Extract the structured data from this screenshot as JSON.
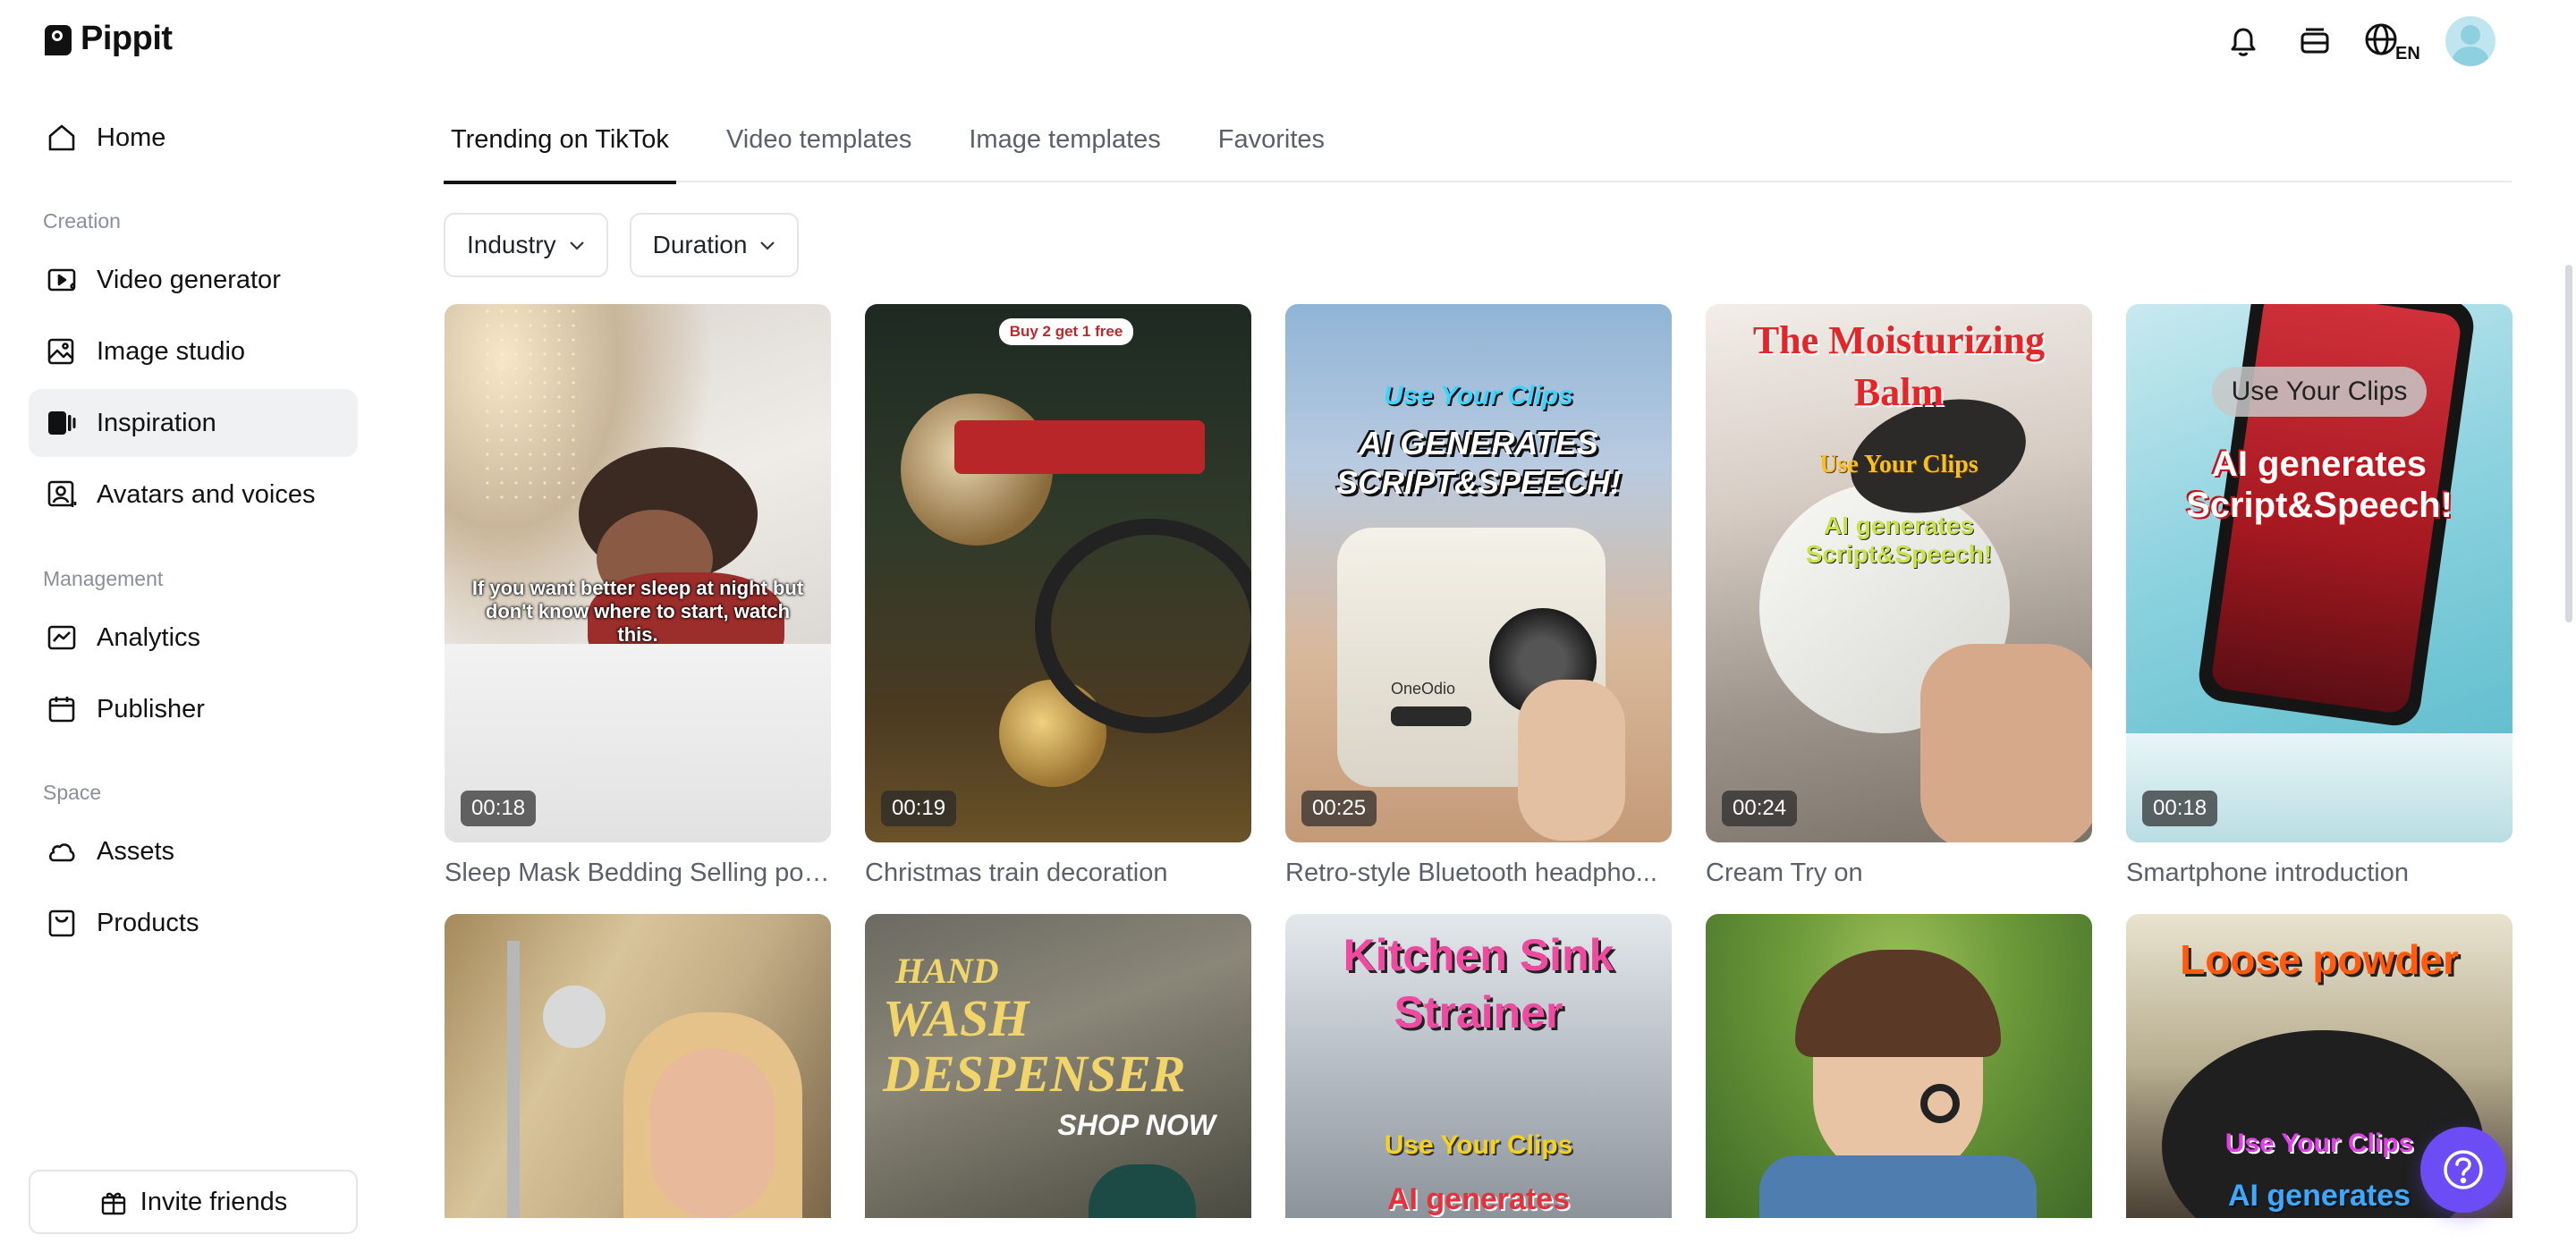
{
  "app": {
    "name": "Pippit"
  },
  "sidebar": {
    "items": [
      {
        "label": "Home",
        "icon": "home-icon"
      },
      {
        "label": "Video generator",
        "icon": "video-generator-icon"
      },
      {
        "label": "Image studio",
        "icon": "image-studio-icon"
      },
      {
        "label": "Inspiration",
        "icon": "inspiration-icon",
        "active": true
      },
      {
        "label": "Avatars and voices",
        "icon": "avatar-voice-icon"
      },
      {
        "label": "Analytics",
        "icon": "analytics-icon"
      },
      {
        "label": "Publisher",
        "icon": "calendar-icon"
      },
      {
        "label": "Assets",
        "icon": "cloud-icon"
      },
      {
        "label": "Products",
        "icon": "bag-icon"
      }
    ],
    "sections": {
      "creation": "Creation",
      "management": "Management",
      "space": "Space"
    },
    "invite_label": "Invite friends"
  },
  "header": {
    "lang": "EN"
  },
  "tabs": [
    {
      "label": "Trending on TikTok",
      "active": true
    },
    {
      "label": "Video templates"
    },
    {
      "label": "Image templates"
    },
    {
      "label": "Favorites"
    }
  ],
  "filters": {
    "industry": "Industry",
    "duration": "Duration"
  },
  "cards": [
    {
      "title": "Sleep Mask Bedding Selling poi...",
      "duration": "00:18",
      "overlay": "If you want better sleep at night but don't know where to start, watch this."
    },
    {
      "title": "Christmas train decoration",
      "duration": "00:19",
      "overlay": "Buy 2 get 1 free"
    },
    {
      "title": "Retro-style Bluetooth headpho...",
      "duration": "00:25",
      "overlay1": "Use Your Clips",
      "overlay2": "AI GENERATES SCRIPT&SPEECH!",
      "brand": "OneOdio"
    },
    {
      "title": "Cream Try on",
      "duration": "00:24",
      "overlay1": "The Moisturizing Balm",
      "overlay2": "Use Your Clips",
      "overlay3": "AI generates Script&Speech!"
    },
    {
      "title": "Smartphone introduction",
      "duration": "00:18",
      "overlay1": "Use Your Clips",
      "overlay2": "AI generates Script&Speech!"
    }
  ],
  "cards_row2": [
    {
      "overlay": ""
    },
    {
      "overlay1": "HAND",
      "overlay2": "WASH DESPENSER",
      "overlay3": "SHOP NOW"
    },
    {
      "overlay1": "Kitchen Sink Strainer",
      "overlay2": "Use Your Clips",
      "overlay3": "AI generates"
    },
    {
      "overlay": ""
    },
    {
      "overlay1": "Loose powder",
      "overlay2": "Use Your Clips",
      "overlay3": "AI generates"
    }
  ]
}
